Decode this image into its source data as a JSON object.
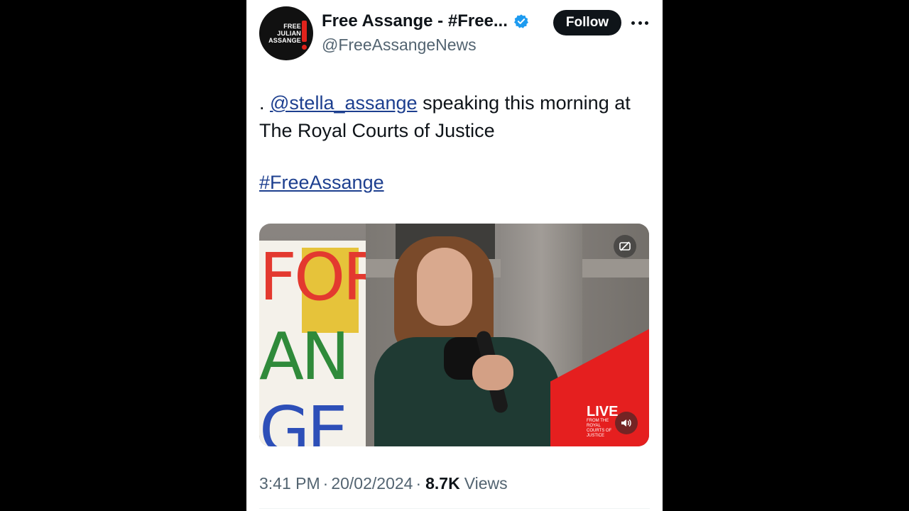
{
  "post": {
    "avatar_text": "FREE\nJULIAN\nASSANGE",
    "display_name": "Free Assange - #Free...",
    "handle": "@FreeAssangeNews",
    "follow_label": "Follow",
    "text_prefix": ". ",
    "mention": "@stella_assange",
    "text_rest": " speaking this morning at The Royal Courts of Justice",
    "hashtag": "#FreeAssange",
    "time": "3:41 PM",
    "separator": "·",
    "date": "20/02/2024",
    "views_count": "8.7K",
    "views_label": "Views"
  },
  "media": {
    "sign_line1": "FOR",
    "sign_line2": "AN",
    "sign_line3": "GE",
    "live_label": "LIVE",
    "live_sub": "FROM THE ROYAL COURTS OF JUSTICE"
  },
  "colors": {
    "link": "#1d3f8f",
    "verified": "#1d9bf0",
    "follow_bg": "#0f1419",
    "live_red": "#e51f1f"
  },
  "icons": [
    "verified-badge-icon",
    "more-options-icon",
    "media-settings-icon",
    "sound-icon"
  ]
}
